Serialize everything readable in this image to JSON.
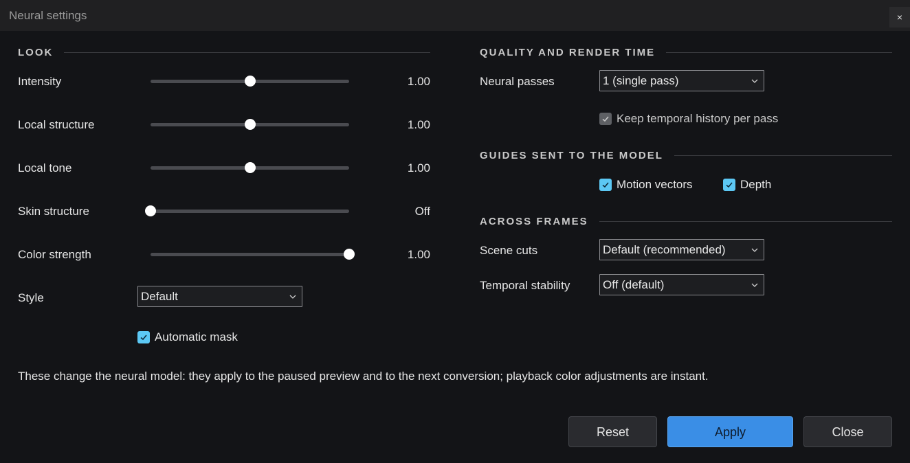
{
  "window": {
    "title": "Neural settings",
    "close_label": "×"
  },
  "look": {
    "heading": "LOOK",
    "sliders": [
      {
        "label": "Intensity",
        "value_text": "1.00",
        "position": 0.5
      },
      {
        "label": "Local structure",
        "value_text": "1.00",
        "position": 0.5
      },
      {
        "label": "Local tone",
        "value_text": "1.00",
        "position": 0.5
      },
      {
        "label": "Skin structure",
        "value_text": "Off",
        "position": 0.0
      },
      {
        "label": "Color strength",
        "value_text": "1.00",
        "position": 1.0
      }
    ],
    "style": {
      "label": "Style",
      "value": "Default"
    },
    "automatic_mask": {
      "label": "Automatic mask",
      "checked": true
    }
  },
  "quality": {
    "heading": "QUALITY AND RENDER TIME",
    "neural_passes": {
      "label": "Neural passes",
      "value": "1 (single pass)"
    },
    "keep_history": {
      "label": "Keep temporal history per pass",
      "checked": true,
      "disabled": true
    }
  },
  "guides": {
    "heading": "GUIDES SENT TO THE MODEL",
    "motion_vectors": {
      "label": "Motion vectors",
      "checked": true
    },
    "depth": {
      "label": "Depth",
      "checked": true
    }
  },
  "across": {
    "heading": "ACROSS FRAMES",
    "scene_cuts": {
      "label": "Scene cuts",
      "value": "Default (recommended)"
    },
    "temporal_stability": {
      "label": "Temporal stability",
      "value": "Off (default)"
    }
  },
  "note": "These change the neural model: they apply to the paused preview and to the next conversion; playback color adjustments are instant.",
  "buttons": {
    "reset": "Reset",
    "apply": "Apply",
    "close": "Close"
  },
  "colors": {
    "accent": "#3a8ee6",
    "checkbox": "#5cc8f4",
    "background": "#131417"
  }
}
